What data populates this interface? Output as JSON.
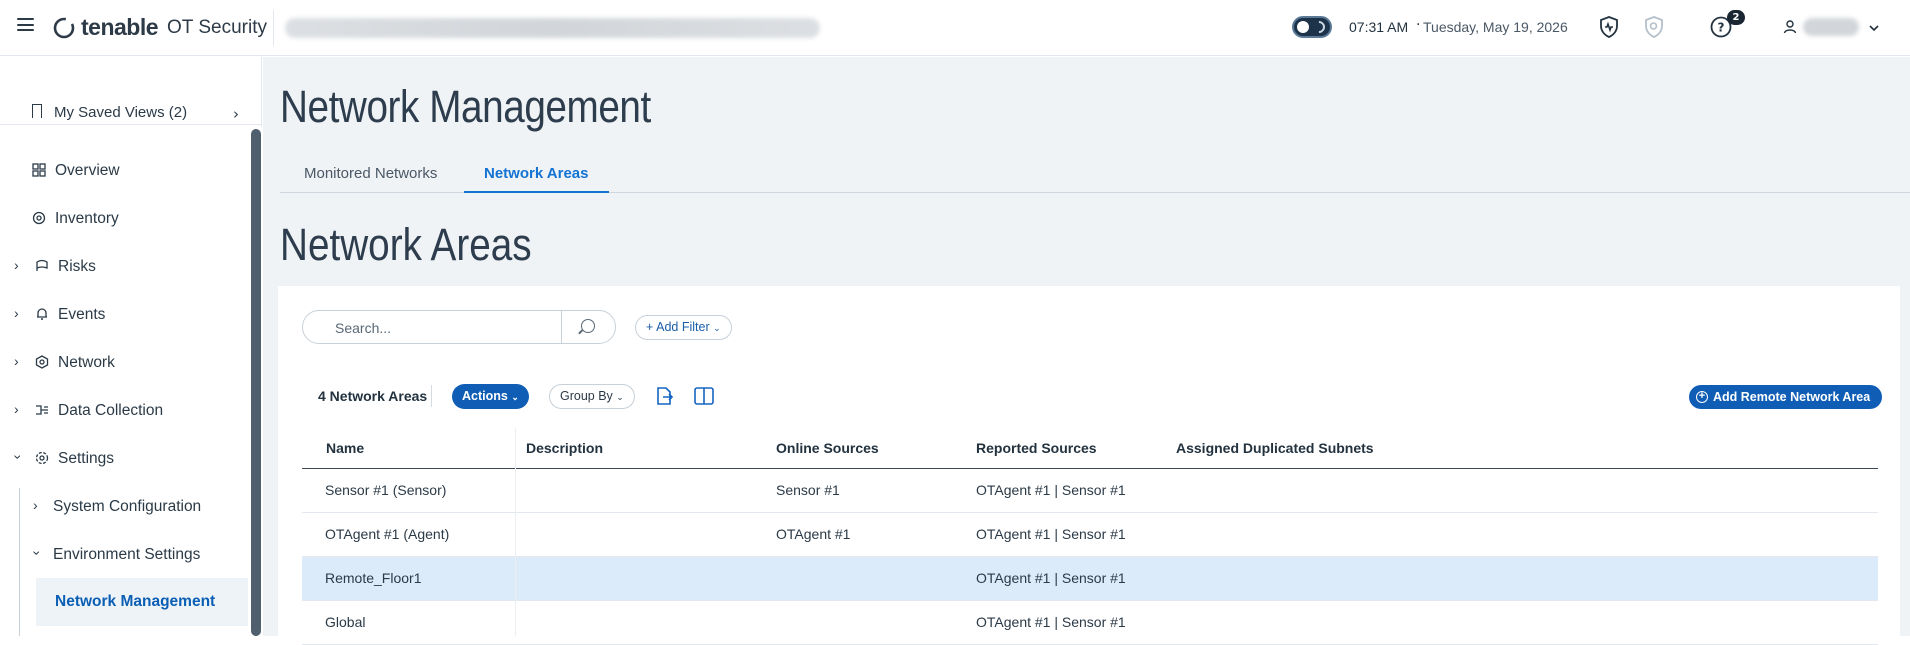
{
  "header": {
    "brand": "tenable",
    "product": "OT Security",
    "time": "07:31 AM",
    "separator": "·",
    "date": "Tuesday, May 19, 2026",
    "notification_count": "2"
  },
  "sidebar": {
    "saved_views": "My Saved Views (2)",
    "items": [
      {
        "label": "Overview"
      },
      {
        "label": "Inventory"
      },
      {
        "label": "Risks"
      },
      {
        "label": "Events"
      },
      {
        "label": "Network"
      },
      {
        "label": "Data Collection"
      },
      {
        "label": "Settings"
      },
      {
        "label": "System Configuration"
      },
      {
        "label": "Environment Settings"
      },
      {
        "label": "Network Management"
      }
    ]
  },
  "main": {
    "page_title": "Network Management",
    "tabs": [
      {
        "label": "Monitored Networks"
      },
      {
        "label": "Network Areas"
      }
    ],
    "section_title": "Network Areas",
    "search_placeholder": "Search...",
    "add_filter": "Add Filter",
    "count_label": "4 Network Areas",
    "actions_label": "Actions",
    "group_by_label": "Group By",
    "add_remote_label": "Add Remote Network Area",
    "columns": [
      "Name",
      "Description",
      "Online Sources",
      "Reported Sources",
      "Assigned Duplicated Subnets"
    ],
    "rows": [
      {
        "name": "Sensor #1 (Sensor)",
        "description": "",
        "online": "Sensor #1",
        "reported": "OTAgent #1 | Sensor #1",
        "subnets": ""
      },
      {
        "name": "OTAgent #1 (Agent)",
        "description": "",
        "online": "OTAgent #1",
        "reported": "OTAgent #1 | Sensor #1",
        "subnets": ""
      },
      {
        "name": "Remote_Floor1",
        "description": "",
        "online": "",
        "reported": "OTAgent #1 | Sensor #1",
        "subnets": ""
      },
      {
        "name": "Global",
        "description": "",
        "online": "",
        "reported": "OTAgent #1 | Sensor #1",
        "subnets": ""
      }
    ]
  },
  "colors": {
    "accent": "#1273d4",
    "primary_button": "#0f5db5",
    "selected_row": "#dcebfa",
    "content_bg": "#f0f3f6"
  },
  "icons": [
    "menu-icon",
    "tenable-logo-icon",
    "theme-toggle-icon",
    "shield-icon",
    "shield-search-icon",
    "help-icon",
    "user-icon",
    "chevron-down-icon",
    "bookmark-icon",
    "overview-icon",
    "inventory-icon",
    "risks-icon",
    "events-bell-icon",
    "network-icon",
    "data-collection-icon",
    "settings-gear-icon",
    "search-icon",
    "plus-icon",
    "export-icon",
    "columns-icon",
    "add-circle-icon"
  ]
}
